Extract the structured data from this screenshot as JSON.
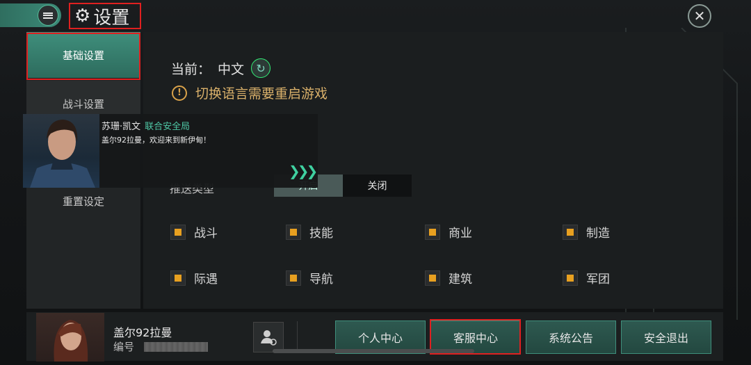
{
  "header": {
    "title": "设置"
  },
  "sidebar": {
    "items": [
      {
        "label": "基础设置",
        "active": true
      },
      {
        "label": "战斗设置"
      },
      {
        "label": "重置设定"
      }
    ]
  },
  "language": {
    "current_label": "当前：",
    "current_value": "中文",
    "warning": "切换语言需要重启游戏"
  },
  "push": {
    "label": "推送类型",
    "on_label": "开启",
    "off_label": "关闭"
  },
  "categories": [
    "战斗",
    "技能",
    "商业",
    "制造",
    "际遇",
    "导航",
    "建筑",
    "军团"
  ],
  "notification": {
    "speaker": "苏珊·凯文",
    "org": "联合安全局",
    "message": "盖尔92拉曼，欢迎来到新伊甸！"
  },
  "player": {
    "name": "盖尔92拉曼",
    "id_label": "编号"
  },
  "bottom_buttons": [
    "个人中心",
    "客服中心",
    "系统公告",
    "安全退出"
  ],
  "colors": {
    "accent": "#3f8f7c",
    "highlight": "#e02020",
    "warning": "#d9a24a"
  }
}
